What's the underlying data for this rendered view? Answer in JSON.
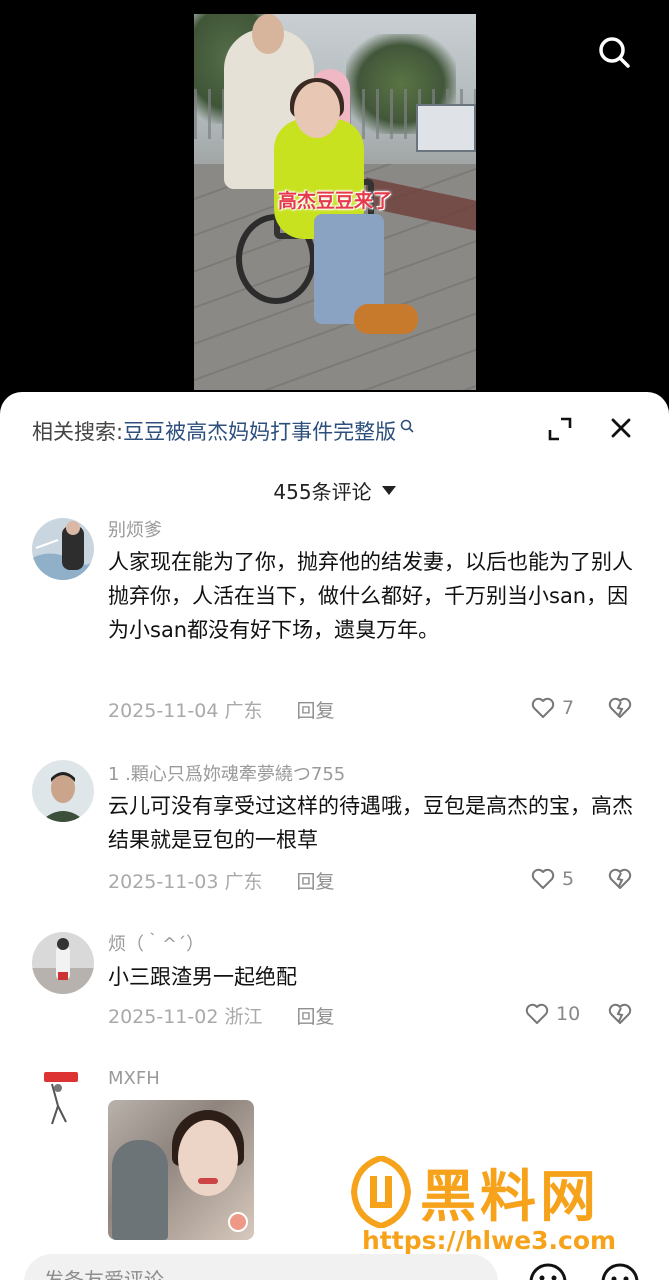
{
  "video": {
    "caption": "高杰豆豆来了"
  },
  "panel": {
    "related_label": "相关搜索:",
    "related_query": "豆豆被高杰妈妈打事件完整版",
    "comment_count": "455条评论"
  },
  "comments": [
    {
      "username": "别烦爹",
      "text": "人家现在能为了你，抛弃他的结发妻，以后也能为了别人抛弃你，人活在当下，做什么都好，千万别当小san，因为小san都没有好下场，遗臭万年。",
      "date": "2025-11-04",
      "location": "广东",
      "reply": "回复",
      "likes": "7"
    },
    {
      "username": "1 .顆心只爲妳魂牽夢繞つ755",
      "text": "云儿可没有享受过这样的待遇哦，豆包是高杰的宝，高杰结果就是豆包的一根草",
      "date": "2025-11-03",
      "location": "广东",
      "reply": "回复",
      "likes": "5"
    },
    {
      "username": "烦（｀^´）",
      "text": "小三跟渣男一起绝配",
      "date": "2025-11-02",
      "location": "浙江",
      "reply": "回复",
      "likes": "10"
    },
    {
      "username": "MXFH"
    }
  ],
  "input": {
    "placeholder": "发条友爱评论"
  },
  "watermark": {
    "title": "黑料网",
    "url": "https://hlwe3.com"
  },
  "colors": {
    "link": "#2d4f7c",
    "caption": "#e63a4a",
    "watermark": "#f7a21b"
  }
}
